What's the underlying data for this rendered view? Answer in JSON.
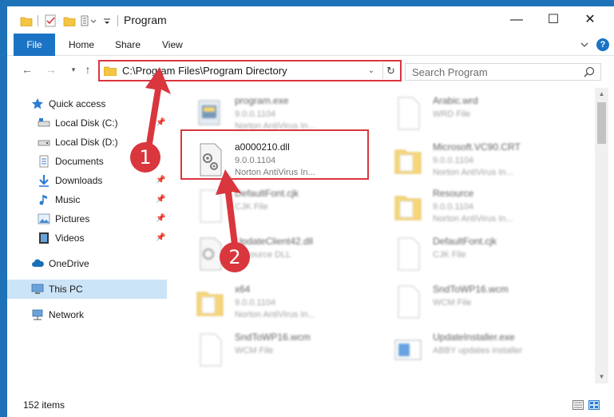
{
  "window": {
    "title": "Program",
    "minimize": "—",
    "maximize": "☐",
    "close": "✕"
  },
  "ribbon": {
    "file": "File",
    "home": "Home",
    "share": "Share",
    "view": "View",
    "help": "?"
  },
  "nav": {
    "back": "←",
    "forward": "→",
    "recent": "▾",
    "up": "↑",
    "address": "C:\\Program Files\\Program Directory",
    "address_dropdown": "⌄",
    "refresh": "↻",
    "search_placeholder": "Search Program"
  },
  "sidebar": {
    "items": [
      {
        "label": "Quick access",
        "icon": "star-icon"
      },
      {
        "label": "Local Disk (C:)",
        "icon": "drive-icon"
      },
      {
        "label": "Local Disk (D:)",
        "icon": "drive-icon"
      },
      {
        "label": "Documents",
        "icon": "documents-icon"
      },
      {
        "label": "Downloads",
        "icon": "download-icon"
      },
      {
        "label": "Music",
        "icon": "music-icon"
      },
      {
        "label": "Pictures",
        "icon": "pictures-icon"
      },
      {
        "label": "Videos",
        "icon": "videos-icon"
      },
      {
        "label": "OneDrive",
        "icon": "cloud-icon"
      },
      {
        "label": "This PC",
        "icon": "computer-icon"
      },
      {
        "label": "Network",
        "icon": "network-icon"
      }
    ],
    "pin": "📌"
  },
  "files": [
    {
      "name": "program.exe",
      "meta1": "9.0.0.1104",
      "meta2": "Norton AntiVirus In..."
    },
    {
      "name": "Arabic.wrd",
      "meta1": "WRD File",
      "meta2": ""
    },
    {
      "name": "a0000210.dll",
      "meta1": "9.0.0.1104",
      "meta2": "Norton AntiVirus In..."
    },
    {
      "name": "Microsoft.VC90.CRT",
      "meta1": "9.0.0.1104",
      "meta2": "Norton AntiVirus In..."
    },
    {
      "name": "DefaultFont.cjk",
      "meta1": "CJK File",
      "meta2": ""
    },
    {
      "name": "Resource",
      "meta1": "9.0.0.1104",
      "meta2": "Norton AntiVirus In..."
    },
    {
      "name": "UpdateClient42.dll",
      "meta1": "Resource DLL",
      "meta2": ""
    },
    {
      "name": "DefaultFont.cjk",
      "meta1": "CJK File",
      "meta2": ""
    },
    {
      "name": "x64",
      "meta1": "9.0.0.1104",
      "meta2": "Norton AntiVirus In..."
    },
    {
      "name": "SndToWP16.wcm",
      "meta1": "WCM File",
      "meta2": ""
    },
    {
      "name": "SndToWP16.wcm",
      "meta1": "WCM File",
      "meta2": ""
    },
    {
      "name": "UpdateInstaller.exe",
      "meta1": "ABBY updates installer",
      "meta2": ""
    }
  ],
  "status": {
    "count": "152 items"
  },
  "annotations": {
    "badge1": "1",
    "badge2": "2",
    "color": "#d9363e"
  }
}
